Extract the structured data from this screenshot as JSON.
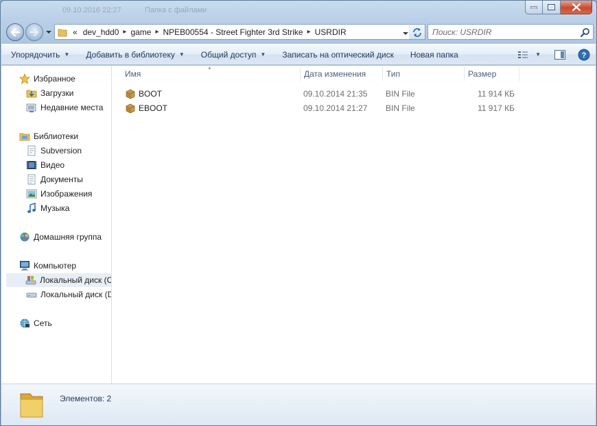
{
  "window": {
    "ghost_lines": [
      {
        "date": "09.10.2016 22:27",
        "label": "Папка с файлами"
      },
      {
        "date": "09.10.2016 22:27",
        "label": "Папка с файлами"
      }
    ]
  },
  "address": {
    "overflow": "«",
    "segments": [
      "dev_hdd0",
      "game",
      "NPEB00554 - Street Fighter 3rd Strike",
      "USRDIR"
    ]
  },
  "search": {
    "placeholder": "Поиск: USRDIR"
  },
  "toolbar": {
    "organize": "Упорядочить",
    "add_library": "Добавить в библиотеку",
    "share": "Общий доступ",
    "burn": "Записать на оптический диск",
    "new_folder": "Новая папка"
  },
  "sidebar": {
    "favorites": {
      "label": "Избранное",
      "items": [
        {
          "label": "Загрузки",
          "icon": "downloads-icon"
        },
        {
          "label": "Недавние места",
          "icon": "recent-places-icon"
        }
      ]
    },
    "libraries": {
      "label": "Библиотеки",
      "items": [
        {
          "label": "Subversion",
          "icon": "library-doc-icon"
        },
        {
          "label": "Видео",
          "icon": "video-icon"
        },
        {
          "label": "Документы",
          "icon": "documents-icon"
        },
        {
          "label": "Изображения",
          "icon": "pictures-icon"
        },
        {
          "label": "Музыка",
          "icon": "music-icon"
        }
      ]
    },
    "homegroup": {
      "label": "Домашняя группа"
    },
    "computer": {
      "label": "Компьютер",
      "items": [
        {
          "label": "Локальный диск (C",
          "icon": "system-drive-icon"
        },
        {
          "label": "Локальный диск (D",
          "icon": "drive-icon"
        }
      ]
    },
    "network": {
      "label": "Сеть"
    }
  },
  "columns": {
    "name": "Имя",
    "date": "Дата изменения",
    "type": "Тип",
    "size": "Размер"
  },
  "files": [
    {
      "name": "BOOT",
      "date": "09.10.2014 21:35",
      "type": "BIN File",
      "size": "11 914 КБ"
    },
    {
      "name": "EBOOT",
      "date": "09.10.2014 21:27",
      "type": "BIN File",
      "size": "11 917 КБ"
    }
  ],
  "status": {
    "count": "Элементов: 2"
  },
  "colors": {
    "accent": "#1e395b",
    "selection": "#e8eef5",
    "close_button": "#c94a2e"
  }
}
